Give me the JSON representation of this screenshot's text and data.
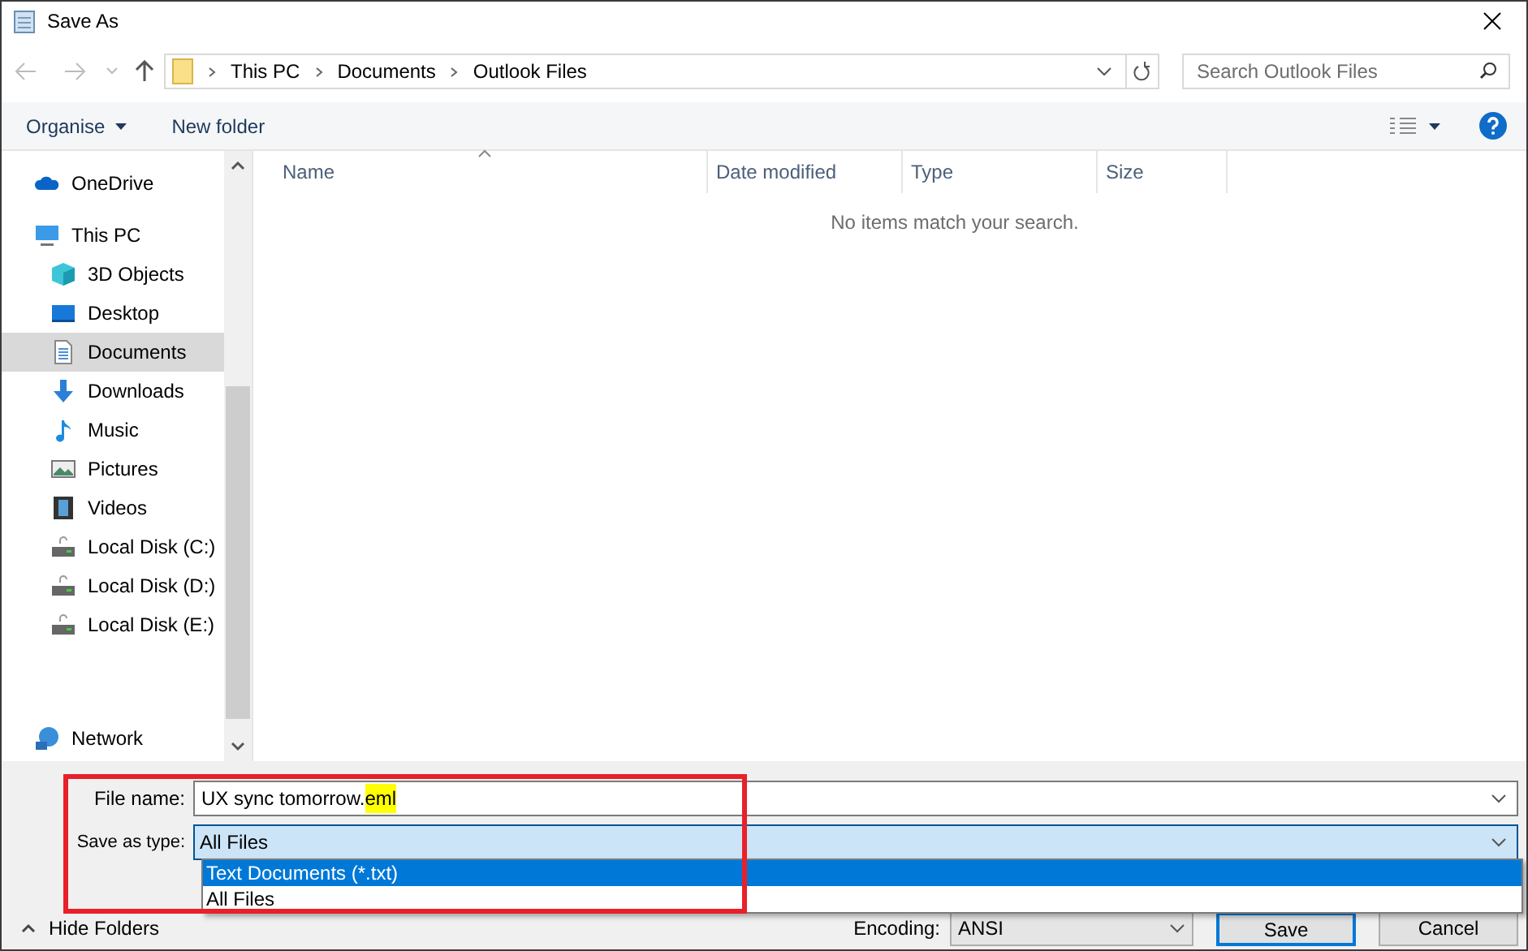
{
  "window": {
    "title": "Save As"
  },
  "address": {
    "path": [
      "This PC",
      "Documents",
      "Outlook Files"
    ]
  },
  "search": {
    "placeholder": "Search Outlook Files"
  },
  "toolbar": {
    "organise": "Organise",
    "new_folder": "New folder"
  },
  "sidebar": {
    "items": [
      {
        "label": "OneDrive",
        "kind": "onedrive",
        "selected": false
      },
      {
        "label": "This PC",
        "kind": "pc",
        "selected": false,
        "children": [
          {
            "label": "3D Objects",
            "kind": "cube",
            "selected": false
          },
          {
            "label": "Desktop",
            "kind": "desktop",
            "selected": false
          },
          {
            "label": "Documents",
            "kind": "document",
            "selected": true
          },
          {
            "label": "Downloads",
            "kind": "download",
            "selected": false
          },
          {
            "label": "Music",
            "kind": "music",
            "selected": false
          },
          {
            "label": "Pictures",
            "kind": "pictures",
            "selected": false
          },
          {
            "label": "Videos",
            "kind": "videos",
            "selected": false
          },
          {
            "label": "Local Disk (C:)",
            "kind": "disk",
            "selected": false
          },
          {
            "label": "Local Disk (D:)",
            "kind": "disk",
            "selected": false
          },
          {
            "label": "Local Disk (E:)",
            "kind": "disk",
            "selected": false
          }
        ]
      },
      {
        "label": "Network",
        "kind": "network",
        "selected": false
      }
    ]
  },
  "columns": [
    "Name",
    "Date modified",
    "Type",
    "Size"
  ],
  "empty_message": "No items match your search.",
  "file_name": {
    "label": "File name:",
    "value": "UX sync tomorrow.",
    "selected_part": "eml"
  },
  "save_as_type": {
    "label": "Save as type:",
    "value": "All Files",
    "options": [
      {
        "label": "Text Documents (*.txt)",
        "highlighted": true
      },
      {
        "label": "All Files",
        "highlighted": false
      }
    ]
  },
  "hide_folders": "Hide Folders",
  "encoding": {
    "label": "Encoding:",
    "value": "ANSI"
  },
  "buttons": [
    "Save",
    "Cancel"
  ]
}
